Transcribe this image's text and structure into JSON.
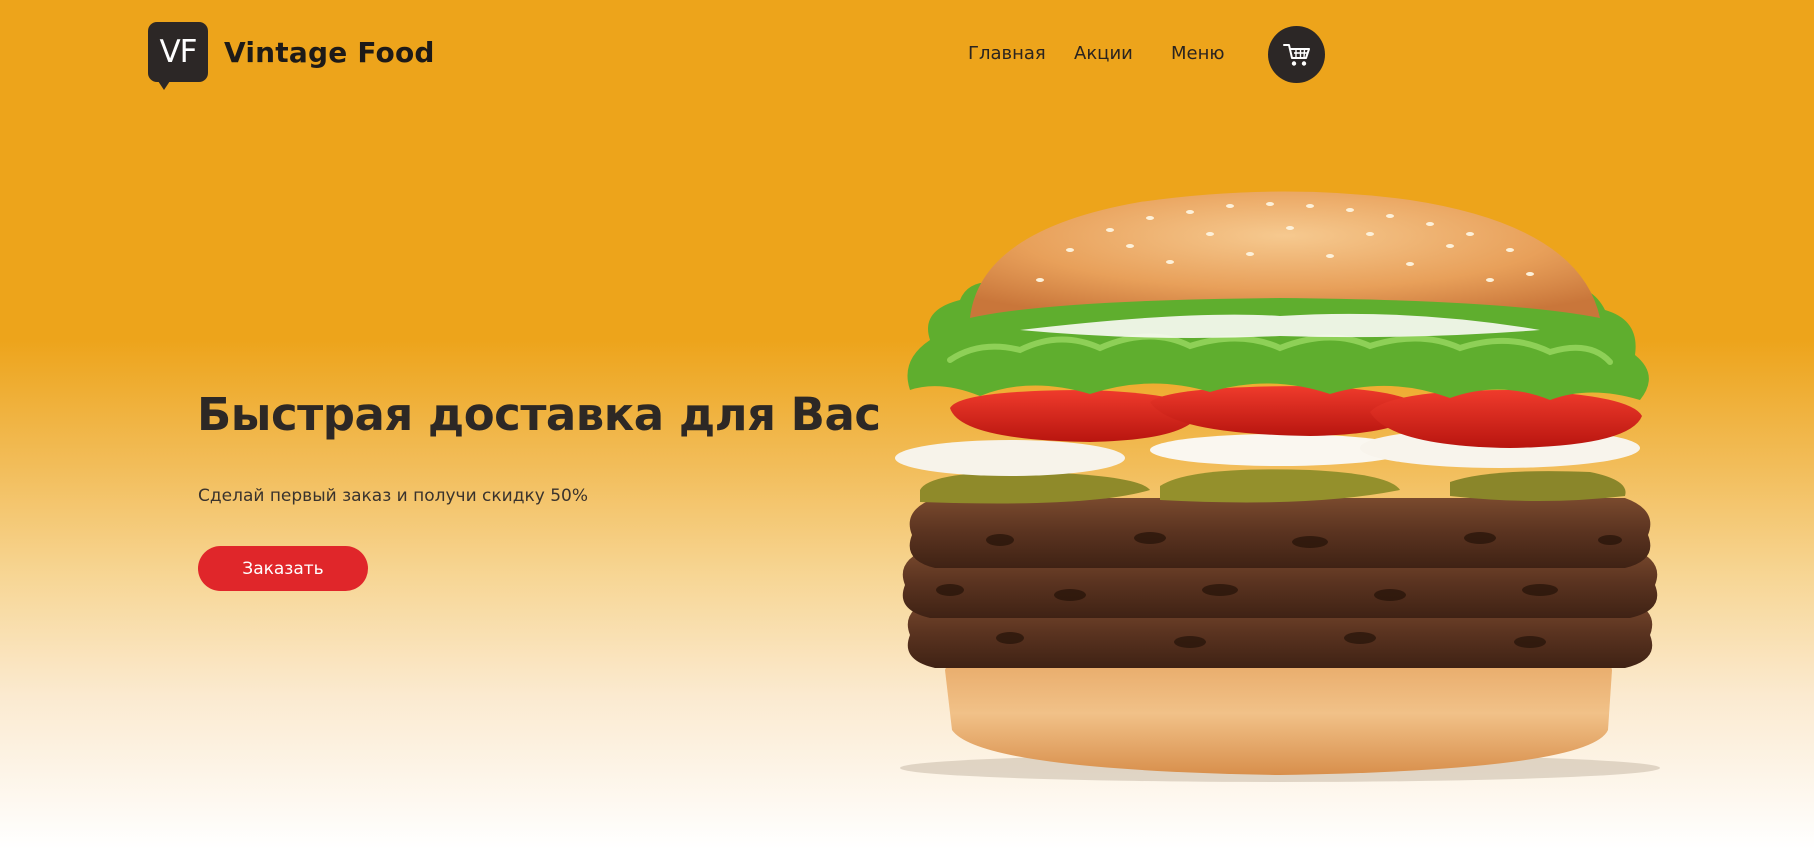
{
  "brand": {
    "logo_initials": "VF",
    "name": "Vintage Food"
  },
  "nav": {
    "items": [
      {
        "label": "Главная"
      },
      {
        "label": "Акции"
      },
      {
        "label": "Меню"
      }
    ],
    "cart_icon": "shopping-cart-icon"
  },
  "hero": {
    "title": "Быстрая доставка для Вас",
    "subtitle": "Сделай первый заказ и получи скидку 50%",
    "cta_label": "Заказать",
    "image": "burger-image"
  },
  "colors": {
    "background_top": "#eda41b",
    "background_bottom": "#ffffff",
    "accent_button": "#e0262a",
    "dark": "#2c2726"
  }
}
